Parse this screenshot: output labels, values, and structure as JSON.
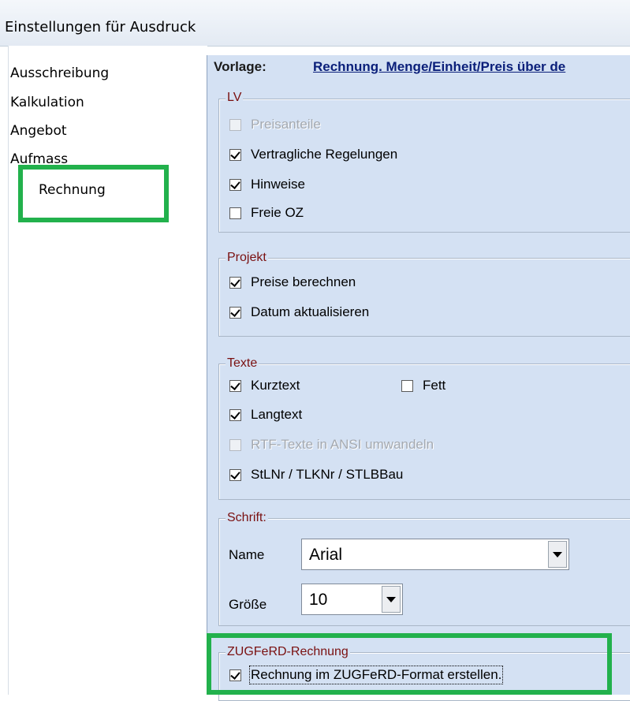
{
  "window": {
    "title": "Einstellungen für Ausdruck"
  },
  "sidebar": {
    "items": [
      {
        "label": "Ausschreibung"
      },
      {
        "label": "Kalkulation"
      },
      {
        "label": "Angebot"
      },
      {
        "label": "Aufmass"
      },
      {
        "label": "Rechnung"
      }
    ],
    "selected": "Rechnung"
  },
  "vorlage": {
    "label": "Vorlage:",
    "value": "Rechnung. Menge/Einheit/Preis über de"
  },
  "groups": {
    "lv": {
      "title": "LV",
      "options": [
        {
          "label": "Preisanteile",
          "checked": false,
          "enabled": false
        },
        {
          "label": "Vertragliche Regelungen",
          "checked": true,
          "enabled": true
        },
        {
          "label": "Hinweise",
          "checked": true,
          "enabled": true
        },
        {
          "label": "Freie OZ",
          "checked": false,
          "enabled": true
        }
      ]
    },
    "projekt": {
      "title": "Projekt",
      "options": [
        {
          "label": "Preise berechnen",
          "checked": true,
          "enabled": true
        },
        {
          "label": "Datum aktualisieren",
          "checked": true,
          "enabled": true
        }
      ]
    },
    "texte": {
      "title": "Texte",
      "options": [
        {
          "label": "Kurztext",
          "checked": true,
          "enabled": true
        },
        {
          "label": "Fett",
          "checked": false,
          "enabled": true
        },
        {
          "label": "Langtext",
          "checked": true,
          "enabled": true
        },
        {
          "label": "RTF-Texte in ANSI umwandeln",
          "checked": false,
          "enabled": false
        },
        {
          "label": "StLNr / TLKNr / STLBBau",
          "checked": true,
          "enabled": true
        }
      ]
    },
    "schrift": {
      "title": "Schrift:",
      "name_label": "Name",
      "name_value": "Arial",
      "size_label": "Größe",
      "size_value": "10"
    },
    "zugferd": {
      "title": "ZUGFeRD-Rechnung",
      "options": [
        {
          "label": "Rechnung im ZUGFeRD-Format erstellen.",
          "checked": true,
          "enabled": true
        }
      ]
    }
  },
  "colors": {
    "panel_bg": "#d4e1f3",
    "highlight": "#22b14c",
    "legend_text": "#7a1010",
    "link": "#0a1f7a"
  }
}
